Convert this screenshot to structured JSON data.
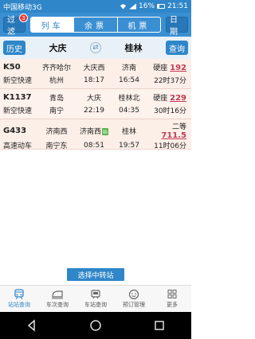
{
  "status_bar": {
    "carrier": "中国移动3G",
    "battery": "16%",
    "time": "21:51"
  },
  "header": {
    "filter_label": "过滤",
    "filter_badge": "3",
    "tabs": [
      {
        "label": "列车",
        "active": true
      },
      {
        "label": "余票",
        "active": false
      },
      {
        "label": "机票",
        "active": false
      }
    ],
    "date_label": "日期"
  },
  "route": {
    "history_label": "历史",
    "from": "大庆",
    "to": "桂林",
    "query_label": "查询",
    "swap_icon": "swap-icon"
  },
  "trains": [
    {
      "number": "K50",
      "type": "新空快速",
      "origin": "齐齐哈尔",
      "dest": "杭州",
      "board_station": "大庆西",
      "depart_time": "18:17",
      "arrive_station": "济南",
      "arrive_time": "16:54",
      "seat_type": "硬座",
      "seat_count": "192",
      "duration": "22时37分"
    },
    {
      "number": "K1137",
      "type": "新空快速",
      "origin": "青岛",
      "dest": "南宁",
      "board_station": "大庆",
      "depart_time": "22:19",
      "arrive_station": "桂林北",
      "arrive_time": "04:35",
      "seat_type": "硬座",
      "seat_count": "229",
      "duration": "30时16分"
    },
    {
      "number": "G433",
      "type": "高速动车",
      "origin": "济南西",
      "dest": "南宁东",
      "board_station": "济南西",
      "board_tag": "始",
      "depart_time": "08:51",
      "arrive_station": "桂林",
      "arrive_time": "19:57",
      "seat_type": "二等",
      "seat_count": "711.5",
      "duration": "11时06分"
    }
  ],
  "transfer_button": "选择中转站",
  "bottom_nav": [
    {
      "label": "站站查询",
      "icon": "train-search-icon",
      "active": true
    },
    {
      "label": "车次查询",
      "icon": "train-icon",
      "active": false
    },
    {
      "label": "车站查询",
      "icon": "station-icon",
      "active": false
    },
    {
      "label": "预订管理",
      "icon": "face-icon",
      "active": false
    },
    {
      "label": "更多",
      "icon": "grid-icon",
      "active": false
    }
  ],
  "colors": {
    "primary": "#2f86c8",
    "seat_value": "#c03a54",
    "row_bg": "#fcefe8"
  }
}
